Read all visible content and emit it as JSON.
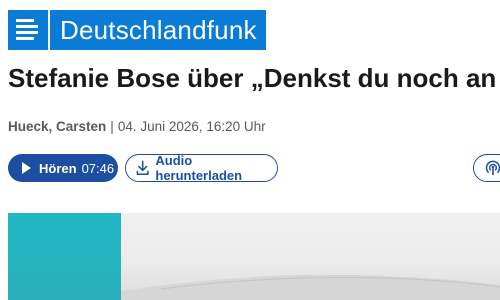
{
  "brand": {
    "name": "Deutschlandfunk",
    "color": "#0b7bd8"
  },
  "article": {
    "title": "Stefanie Bose über „Denkst du noch an",
    "author": "Hueck, Carsten",
    "separator": "|",
    "date": "04. Juni 2026, 16:20 Uhr"
  },
  "player": {
    "play_label": "Hören",
    "duration": "07:46",
    "play_icon": "play-icon",
    "download_label": "Audio herunterladen",
    "download_icon": "download-icon",
    "podcast_icon": "podcast-icon",
    "accent": "#1c4fa1"
  }
}
